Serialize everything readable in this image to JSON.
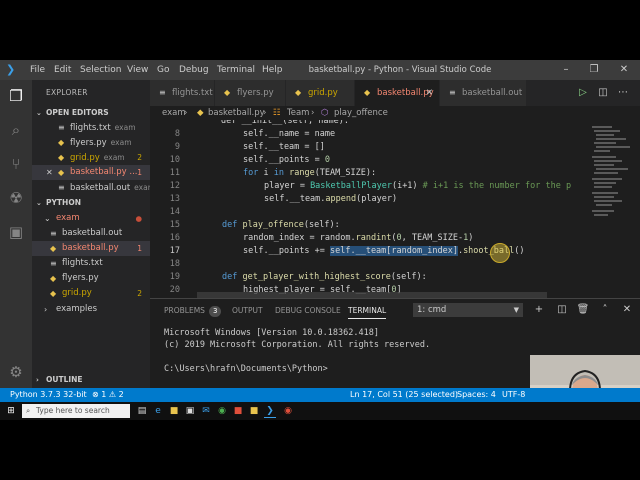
{
  "title_bar": {
    "menu": [
      "File",
      "Edit",
      "Selection",
      "View",
      "Go",
      "Debug",
      "Terminal",
      "Help"
    ],
    "window_title": "basketball.py - Python - Visual Studio Code"
  },
  "sidebar": {
    "title": "EXPLORER",
    "open_editors_label": "OPEN EDITORS",
    "open_editors": [
      {
        "name": "flights.txt",
        "folder": "exam",
        "badge": ""
      },
      {
        "name": "flyers.py",
        "folder": "exam",
        "badge": ""
      },
      {
        "name": "grid.py",
        "folder": "exam",
        "badge": "2"
      },
      {
        "name": "basketball.py ...",
        "folder": "",
        "badge": "1"
      },
      {
        "name": "basketball.out",
        "folder": "exam",
        "badge": ""
      }
    ],
    "workspace_label": "PYTHON",
    "tree": [
      {
        "name": "exam",
        "badge": ""
      },
      {
        "name": "basketball.out",
        "badge": ""
      },
      {
        "name": "basketball.py",
        "badge": "1"
      },
      {
        "name": "flights.txt",
        "badge": ""
      },
      {
        "name": "flyers.py",
        "badge": ""
      },
      {
        "name": "grid.py",
        "badge": "2"
      },
      {
        "name": "examples",
        "badge": ""
      }
    ],
    "outline_label": "OUTLINE"
  },
  "tabs": [
    "flights.txt",
    "flyers.py",
    "grid.py",
    "basketball.py",
    "basketball.out"
  ],
  "breadcrumb": {
    "folder": "exam",
    "file": "basketball.py",
    "cls": "Team",
    "method": "play_offence"
  },
  "editor": {
    "line_numbers": [
      "8",
      "9",
      "10",
      "11",
      "12",
      "13",
      "14",
      "15",
      "16",
      "17",
      "18",
      "19",
      "20"
    ],
    "partial_top": "def __init__(self, name):",
    "lines": {
      "l8a": "self.__name = name",
      "l9a": "self.__team = []",
      "l10a": "self.__points = ",
      "l10n": "0",
      "l11k": "for",
      "l11a": " i ",
      "l11b": "in",
      "l11c": " ",
      "l11f": "range",
      "l11d": "(TEAM_SIZE):",
      "l12a": "player = ",
      "l12c": "BasketballPlayer",
      "l12b": "(i+1) ",
      "l12m": "# i+1 is the number for the p",
      "l13a": "self.__team.",
      "l13f": "append",
      "l13b": "(player)",
      "l15k": "def",
      "l15f": " play_offence",
      "l15b": "(self):",
      "l16a": "random_index = random.",
      "l16f": "randint",
      "l16b": "(",
      "l16n": "0",
      "l16c": ", TEAM_SIZE-",
      "l16n2": "1",
      "l16d": ")",
      "l17a": "self.__points += ",
      "l17s": "self.__team[random_index]",
      "l17b": ".",
      "l17f": "shoot_ball",
      "l17c": "()",
      "l19k": "def",
      "l19f": " get_player_with_highest_score",
      "l19b": "(self):",
      "l20a": "highest_player = self.__team[",
      "l20n": "0",
      "l20b": "]"
    }
  },
  "panel": {
    "tabs": [
      "PROBLEMS",
      "OUTPUT",
      "DEBUG CONSOLE",
      "TERMINAL"
    ],
    "problems_count": "3",
    "terminal_select": "1: cmd",
    "terminal_lines": [
      "Microsoft Windows [Version 10.0.18362.418]",
      "(c) 2019 Microsoft Corporation. All rights reserved.",
      "",
      "C:\\Users\\hrafn\\Documents\\Python>"
    ]
  },
  "status_bar": {
    "interpreter": "Python 3.7.3 32-bit",
    "errors": "1",
    "warnings": "2",
    "position": "Ln 17, Col 51 (25 selected)",
    "spaces": "Spaces: 4",
    "encoding": "UTF-8"
  },
  "taskbar": {
    "search_placeholder": "Type here to search"
  },
  "colors": {
    "accent": "#007acc",
    "selection": "#264f78",
    "keyword": "#569cd6",
    "function": "#dcdcaa"
  }
}
